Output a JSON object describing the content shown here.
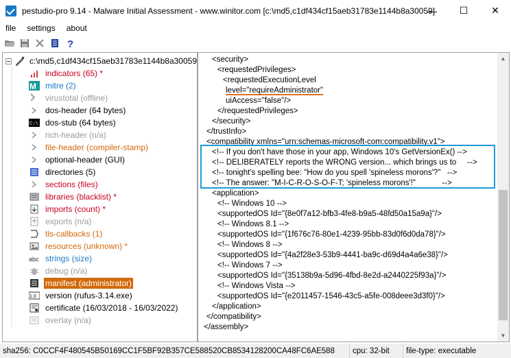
{
  "window": {
    "title": "pestudio-pro 9.14 - Malware Initial Assessment - www.winitor.com [c:\\md5,c1df434cf15aeb31783e1144b8a30059]",
    "controls": {
      "minimize": "—",
      "maximize": "☐",
      "close": "✕"
    }
  },
  "menu": [
    {
      "label": "file"
    },
    {
      "label": "settings"
    },
    {
      "label": "about"
    }
  ],
  "toolbar": [
    "open-icon",
    "save-icon",
    "close-file-icon",
    "list-icon",
    "help-icon"
  ],
  "tree": {
    "root": "c:\\md5,c1df434cf15aeb31783e1144b8a30059",
    "items": [
      {
        "label": "indicators (65) *",
        "color": "red",
        "icon": "indicators-icon"
      },
      {
        "label": "mitre (2)",
        "color": "blue",
        "icon": "mitre-icon"
      },
      {
        "label": "virustotal (offline)",
        "color": "gray",
        "icon": "virustotal-icon"
      },
      {
        "label": "dos-header (64 bytes)",
        "color": "black",
        "icon": "expand-arrow-icon"
      },
      {
        "label": "dos-stub (64 bytes)",
        "color": "black",
        "icon": "dos-stub-icon"
      },
      {
        "label": "rich-header (n/a)",
        "color": "gray",
        "icon": "expand-arrow-icon"
      },
      {
        "label": "file-header (compiler-stamp)",
        "color": "orange",
        "icon": "expand-arrow-icon"
      },
      {
        "label": "optional-header (GUI)",
        "color": "black",
        "icon": "expand-arrow-icon"
      },
      {
        "label": "directories (5)",
        "color": "black",
        "icon": "directories-icon"
      },
      {
        "label": "sections (files)",
        "color": "red",
        "icon": "expand-arrow-icon"
      },
      {
        "label": "libraries (blacklist) *",
        "color": "red",
        "icon": "libraries-icon"
      },
      {
        "label": "imports (count) *",
        "color": "red",
        "icon": "imports-icon"
      },
      {
        "label": "exports (n/a)",
        "color": "gray",
        "icon": "exports-icon"
      },
      {
        "label": "tls-callbacks (1)",
        "color": "orange",
        "icon": "tls-icon"
      },
      {
        "label": "resources (unknown) *",
        "color": "orange",
        "icon": "resources-icon"
      },
      {
        "label": "strings (size)",
        "color": "blue",
        "icon": "strings-icon"
      },
      {
        "label": "debug (n/a)",
        "color": "gray",
        "icon": "debug-icon"
      },
      {
        "label": "manifest (administrator)",
        "color": "selected",
        "icon": "manifest-icon"
      },
      {
        "label": "version (rufus-3.14.exe)",
        "color": "black",
        "icon": "version-icon"
      },
      {
        "label": "certificate (16/03/2018 - 16/03/2022)",
        "color": "black",
        "icon": "certificate-icon"
      },
      {
        "label": "overlay (n/a)",
        "color": "gray",
        "icon": "overlay-icon"
      }
    ]
  },
  "xml_lines": [
    {
      "indent": 12,
      "text": "<security>"
    },
    {
      "indent": 20,
      "text": "<requestedPrivileges>"
    },
    {
      "indent": 28,
      "text": "<requestedExecutionLevel"
    },
    {
      "indent": 32,
      "text": "level=\"requireAdministrator\"",
      "underline": true
    },
    {
      "indent": 32,
      "text": "uiAccess=\"false\"/>"
    },
    {
      "indent": 20,
      "text": "</requestedPrivileges>"
    },
    {
      "indent": 12,
      "text": "</security>"
    },
    {
      "indent": 4,
      "text": "</trustInfo>"
    },
    {
      "indent": 4,
      "text": "<compatibility xmlns=\"urn:schemas-microsoft-com:compatibility.v1\">"
    },
    {
      "indent": 12,
      "text": "<!-- If you don't have those in your app, Windows 10's GetVersionEx() -->"
    },
    {
      "indent": 12,
      "text": "<!-- DELIBERATELY reports the WRONG version... which brings us to     -->"
    },
    {
      "indent": 12,
      "text": "<!-- tonight's spelling bee: \"How do you spell 'spineless morons'?\"   -->"
    },
    {
      "indent": 12,
      "text": "<!-- The answer: \"M-I-C-R-O-S-O-F-T; 'spineless morons'!\"            -->"
    },
    {
      "indent": 12,
      "text": "<application>"
    },
    {
      "indent": 20,
      "text": "<!-- Windows 10 -->"
    },
    {
      "indent": 20,
      "text": "<supportedOS Id=\"{8e0f7a12-bfb3-4fe8-b9a5-48fd50a15a9a}\"/>"
    },
    {
      "indent": 20,
      "text": "<!-- Windows 8.1 -->"
    },
    {
      "indent": 20,
      "text": "<supportedOS Id=\"{1f676c76-80e1-4239-95bb-83d0f6d0da78}\"/>"
    },
    {
      "indent": 20,
      "text": "<!-- Windows 8 -->"
    },
    {
      "indent": 20,
      "text": "<supportedOS Id=\"{4a2f28e3-53b9-4441-ba9c-d69d4a4a6e38}\"/>"
    },
    {
      "indent": 20,
      "text": "<!-- Windows 7 -->"
    },
    {
      "indent": 20,
      "text": "<supportedOS Id=\"{35138b9a-5d96-4fbd-8e2d-a2440225f93a}\"/>"
    },
    {
      "indent": 20,
      "text": "<!-- Windows Vista -->"
    },
    {
      "indent": 20,
      "text": "<supportedOS Id=\"{e2011457-1546-43c5-a5fe-008deee3d3f0}\"/>"
    },
    {
      "indent": 12,
      "text": "</application>"
    },
    {
      "indent": 4,
      "text": "</compatibility>"
    },
    {
      "indent": 0,
      "text": "</assembly>"
    }
  ],
  "status": {
    "sha256": "sha256: C0CCF4F480545B50169CC1F5BF92B357CE588520CB8534128200CA48FC6AE588",
    "cpu": "cpu: 32-bit",
    "filetype": "file-type: executable"
  }
}
